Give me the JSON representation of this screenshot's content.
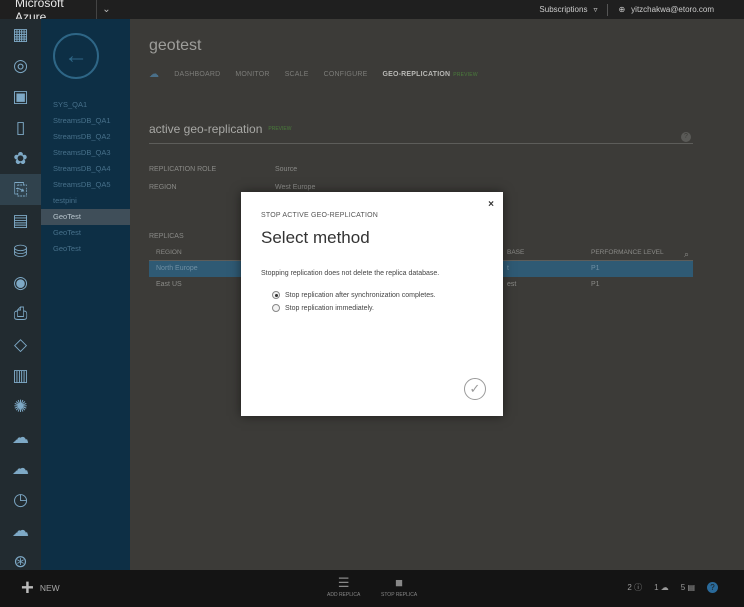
{
  "topbar": {
    "brand": "Microsoft Azure",
    "subscriptions": "Subscriptions",
    "user": "yitzchakwa@etoro.com"
  },
  "rail": {
    "icons": [
      "all-items-icon",
      "websites-icon",
      "virtual-machines-icon",
      "mobile-services-icon",
      "cloud-services-icon",
      "sql-databases-icon",
      "storage-icon",
      "hdinsight-icon",
      "media-services-icon",
      "service-bus-icon",
      "visual-studio-icon",
      "cache-icon",
      "biztalk-icon",
      "recovery-services-icon",
      "cdn-icon",
      "automation-icon",
      "scheduler-icon",
      "api-management-icon"
    ],
    "active_index": 5
  },
  "subnav": {
    "items": [
      "SYS_QA1",
      "StreamsDB_QA1",
      "StreamsDB_QA2",
      "StreamsDB_QA3",
      "StreamsDB_QA4",
      "StreamsDB_QA5",
      "testpini",
      "GeoTest",
      "GeoTest",
      "GeoTest"
    ],
    "active_index": 7
  },
  "main": {
    "title": "geotest",
    "tabs": [
      "DASHBOARD",
      "MONITOR",
      "SCALE",
      "CONFIGURE",
      "GEO-REPLICATION"
    ],
    "active_tab": "GEO-REPLICATION",
    "preview_tag": "PREVIEW",
    "section_title": "active geo-replication",
    "section_preview": "PREVIEW",
    "help": "?",
    "replication_role_label": "REPLICATION ROLE",
    "replication_role_value": "Source",
    "region_label": "REGION",
    "region_value": "West Europe",
    "replicas_label": "REPLICAS",
    "table": {
      "columns": [
        "REGION",
        "BASE",
        "PERFORMANCE LEVEL"
      ],
      "rows": [
        {
          "region": "North Europe",
          "base": "t",
          "perf": "P1",
          "selected": true
        },
        {
          "region": "East US",
          "base": "est",
          "perf": "P1",
          "selected": false
        }
      ]
    }
  },
  "bottombar": {
    "new_label": "NEW",
    "add_replica": "ADD REPLICA",
    "stop_replica": "STOP REPLICA",
    "status_a": "2",
    "status_b": "1",
    "status_c": "5",
    "help": "?"
  },
  "modal": {
    "close": "×",
    "eyebrow": "STOP ACTIVE GEO-REPLICATION",
    "heading": "Select method",
    "note": "Stopping replication does not delete the replica database.",
    "options": [
      {
        "label": "Stop replication after synchronization completes.",
        "checked": true
      },
      {
        "label": "Stop replication immediately.",
        "checked": false
      }
    ],
    "confirm": "✓"
  }
}
